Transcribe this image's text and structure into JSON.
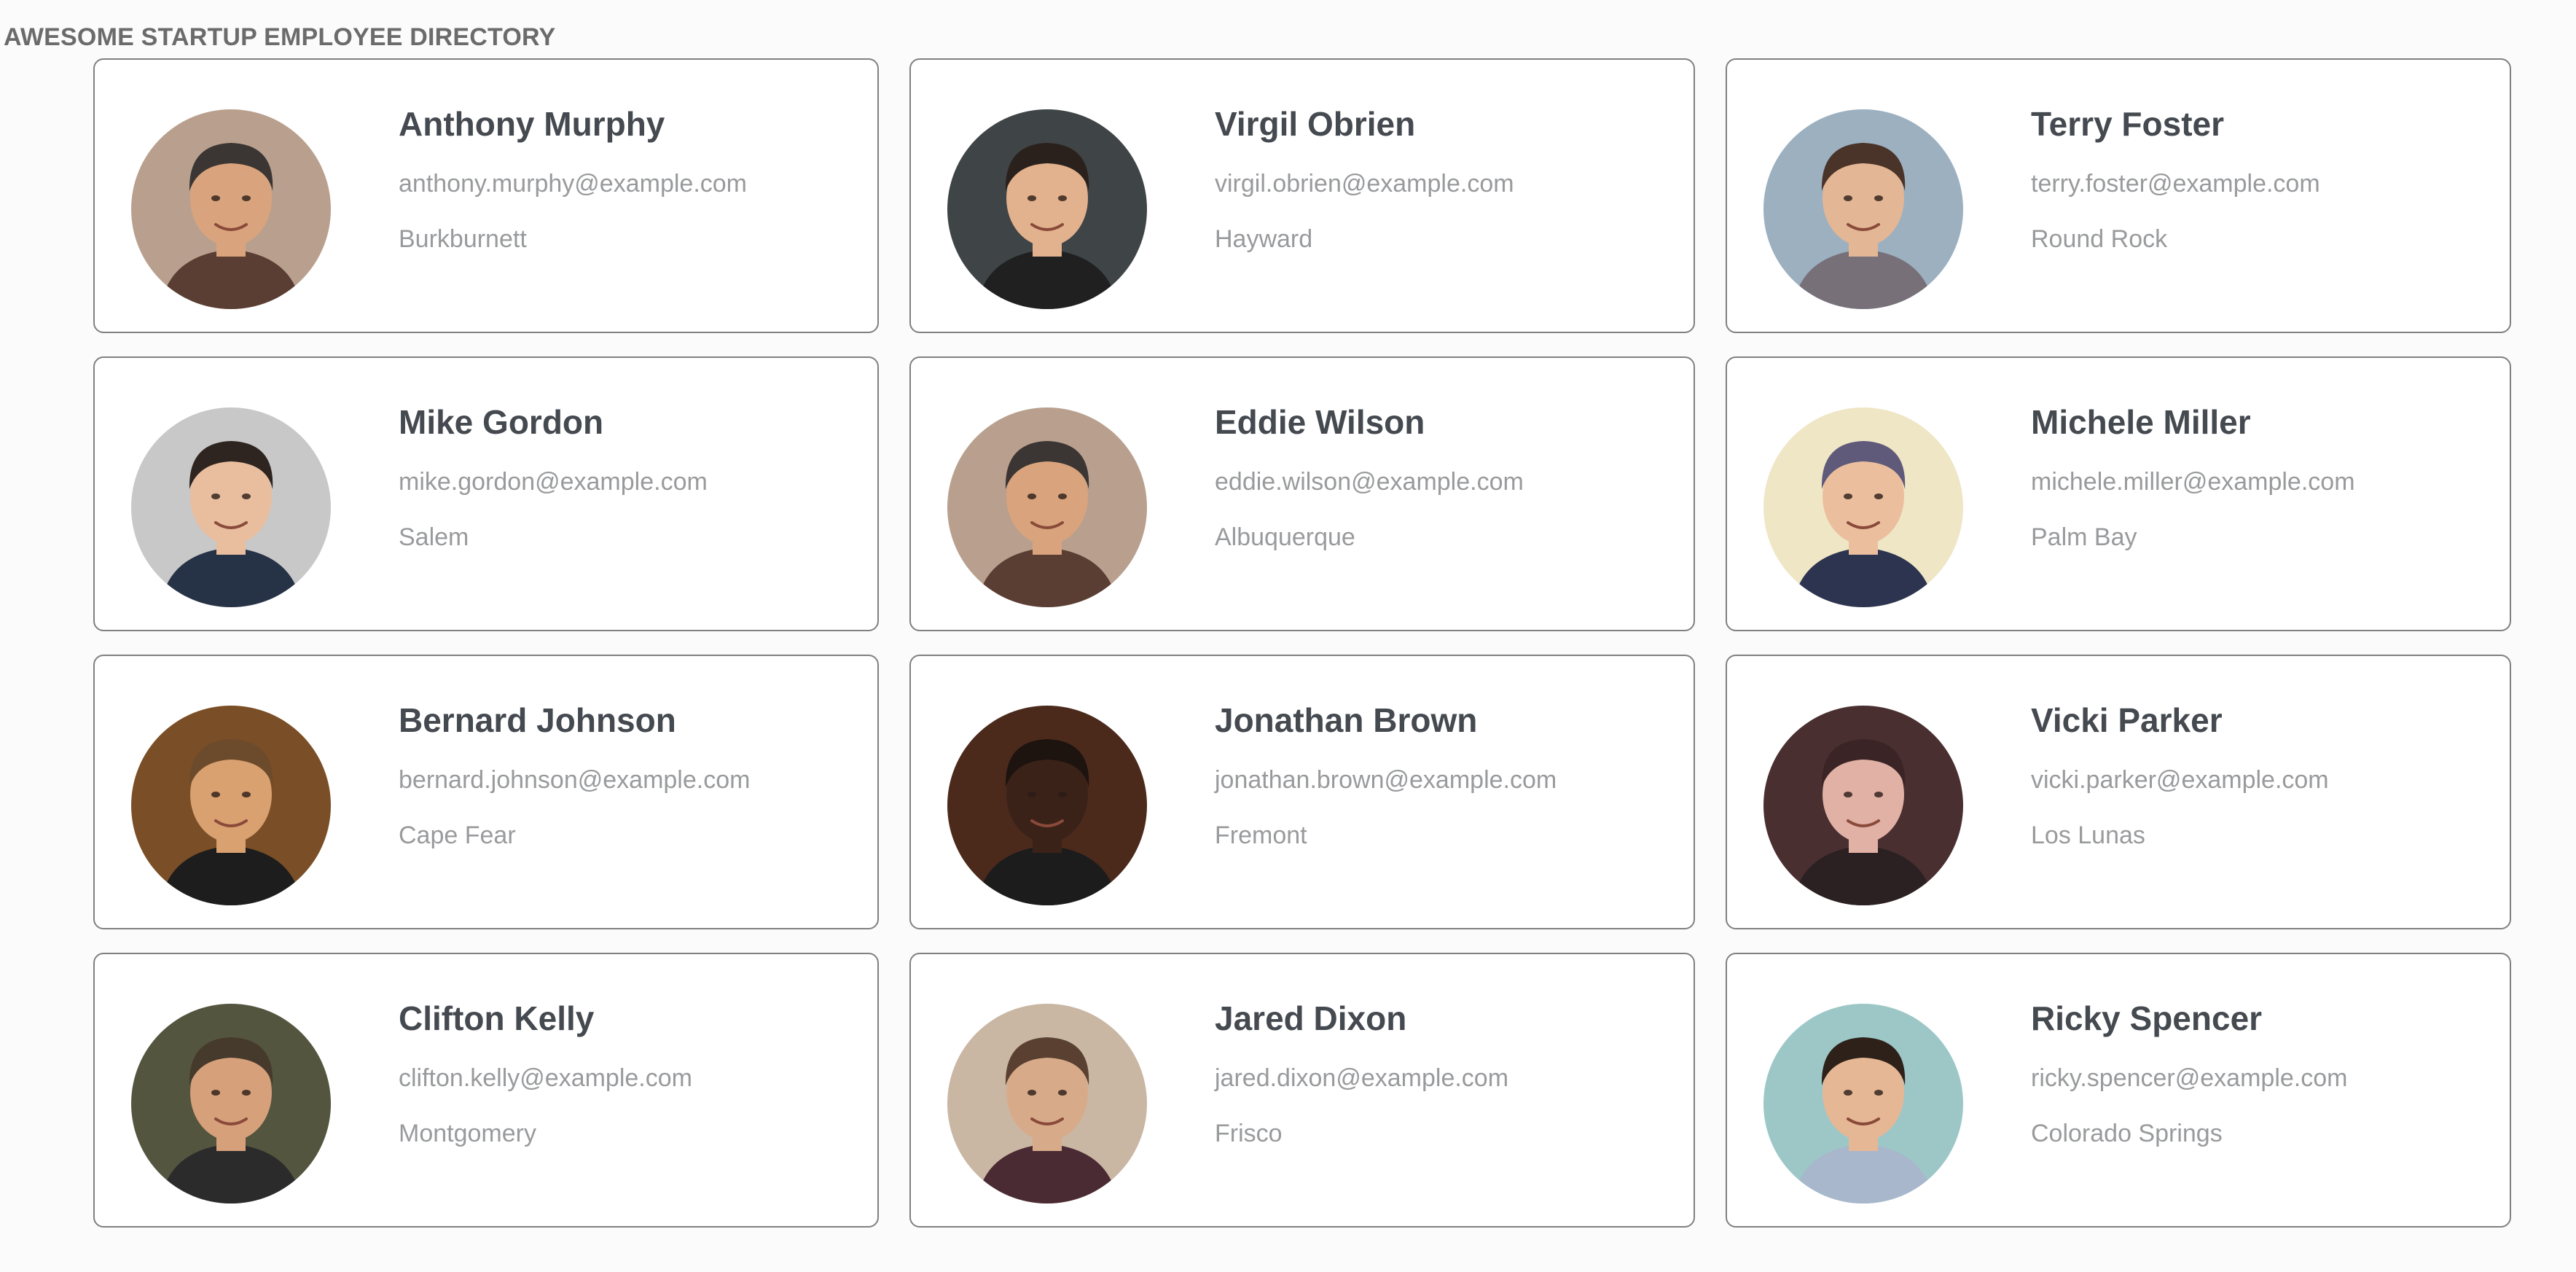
{
  "header": {
    "title": "AWESOME STARTUP EMPLOYEE DIRECTORY"
  },
  "employees": [
    {
      "name": "Anthony Murphy",
      "email": "anthony.murphy@example.com",
      "city": "Burkburnett",
      "photo": {
        "bg": "#b9a08e",
        "hair": "#3b3634",
        "skin": "#d9a47d",
        "shirt": "#5a3d33"
      }
    },
    {
      "name": "Virgil Obrien",
      "email": "virgil.obrien@example.com",
      "city": "Hayward",
      "photo": {
        "bg": "#3f4446",
        "hair": "#2b211c",
        "skin": "#e2b18d",
        "shirt": "#202020"
      }
    },
    {
      "name": "Terry Foster",
      "email": "terry.foster@example.com",
      "city": "Round Rock",
      "photo": {
        "bg": "#9cb0c0",
        "hair": "#4a3328",
        "skin": "#e3b695",
        "shirt": "#777079"
      }
    },
    {
      "name": "Mike Gordon",
      "email": "mike.gordon@example.com",
      "city": "Salem",
      "photo": {
        "bg": "#c8c8c8",
        "hair": "#2f2520",
        "skin": "#e9be9e",
        "shirt": "#263245"
      }
    },
    {
      "name": "Eddie Wilson",
      "email": "eddie.wilson@example.com",
      "city": "Albuquerque",
      "photo": {
        "bg": "#b9a08e",
        "hair": "#3b3634",
        "skin": "#d9a47d",
        "shirt": "#5a3d33"
      }
    },
    {
      "name": "Michele Miller",
      "email": "michele.miller@example.com",
      "city": "Palm Bay",
      "photo": {
        "bg": "#efe6c6",
        "hair": "#5f5a7a",
        "skin": "#ebbf9e",
        "shirt": "#2d3450"
      }
    },
    {
      "name": "Bernard Johnson",
      "email": "bernard.johnson@example.com",
      "city": "Cape Fear",
      "photo": {
        "bg": "#7a4e26",
        "hair": "#6c4b2c",
        "skin": "#d9a070",
        "shirt": "#1d1d1d"
      }
    },
    {
      "name": "Jonathan Brown",
      "email": "jonathan.brown@example.com",
      "city": "Fremont",
      "photo": {
        "bg": "#4b2a1c",
        "hair": "#1d130f",
        "skin": "#3b2219",
        "shirt": "#1c1c1c"
      }
    },
    {
      "name": "Vicki Parker",
      "email": "vicki.parker@example.com",
      "city": "Los Lunas",
      "photo": {
        "bg": "#4a2f31",
        "hair": "#3a2426",
        "skin": "#e0b1a4",
        "shirt": "#2b2022"
      }
    },
    {
      "name": "Clifton Kelly",
      "email": "clifton.kelly@example.com",
      "city": "Montgomery",
      "photo": {
        "bg": "#54553f",
        "hair": "#463a2c",
        "skin": "#d6a07b",
        "shirt": "#2b2b2b"
      }
    },
    {
      "name": "Jared Dixon",
      "email": "jared.dixon@example.com",
      "city": "Frisco",
      "photo": {
        "bg": "#c9b7a4",
        "hair": "#5a4030",
        "skin": "#d7ab8a",
        "shirt": "#4a2a33"
      }
    },
    {
      "name": "Ricky Spencer",
      "email": "ricky.spencer@example.com",
      "city": "Colorado Springs",
      "photo": {
        "bg": "#9dc7c7",
        "hair": "#2d2119",
        "skin": "#e6b794",
        "shirt": "#a8b7cc"
      }
    }
  ]
}
